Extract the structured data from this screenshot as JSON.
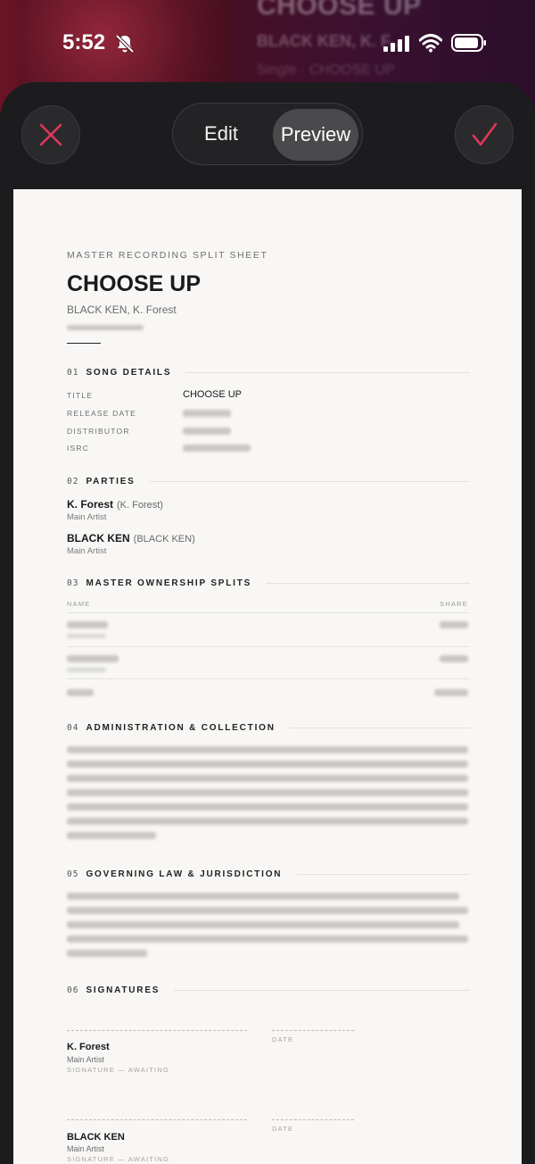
{
  "status_bar": {
    "time": "5:52"
  },
  "background_header": {
    "title": "CHOOSE UP",
    "artist": "BLACK KEN, K. F...",
    "subtitle": "Single · CHOOSE UP"
  },
  "toolbar": {
    "tabs": [
      {
        "label": "Edit",
        "selected": false
      },
      {
        "label": "Preview",
        "selected": true
      }
    ],
    "accent_color": "#e0375a"
  },
  "document": {
    "eyebrow": "MASTER RECORDING SPLIT SHEET",
    "title": "CHOOSE UP",
    "artists": "BLACK KEN, K. Forest",
    "sections": {
      "song_details": {
        "number": "01",
        "title": "SONG DETAILS",
        "rows": [
          {
            "label": "TITLE",
            "value": "CHOOSE UP"
          },
          {
            "label": "RELEASE DATE",
            "value": ""
          },
          {
            "label": "DISTRIBUTOR",
            "value": ""
          },
          {
            "label": "ISRC",
            "value": ""
          }
        ]
      },
      "parties": {
        "number": "02",
        "title": "PARTIES",
        "items": [
          {
            "name": "K. Forest",
            "legal": "(K. Forest)",
            "role": "Main Artist"
          },
          {
            "name": "BLACK KEN",
            "legal": "(BLACK KEN)",
            "role": "Main Artist"
          }
        ]
      },
      "splits": {
        "number": "03",
        "title": "MASTER OWNERSHIP SPLITS",
        "col_name": "NAME",
        "col_share": "SHARE"
      },
      "administration": {
        "number": "04",
        "title": "ADMINISTRATION & COLLECTION"
      },
      "governing_law": {
        "number": "05",
        "title": "GOVERNING LAW & JURISDICTION"
      },
      "signatures": {
        "number": "06",
        "title": "SIGNATURES",
        "date_label": "DATE",
        "items": [
          {
            "name": "K. Forest",
            "role": "Main Artist",
            "status": "SIGNATURE — AWAITING"
          },
          {
            "name": "BLACK KEN",
            "role": "Main Artist",
            "status": "SIGNATURE — AWAITING"
          }
        ]
      }
    }
  }
}
